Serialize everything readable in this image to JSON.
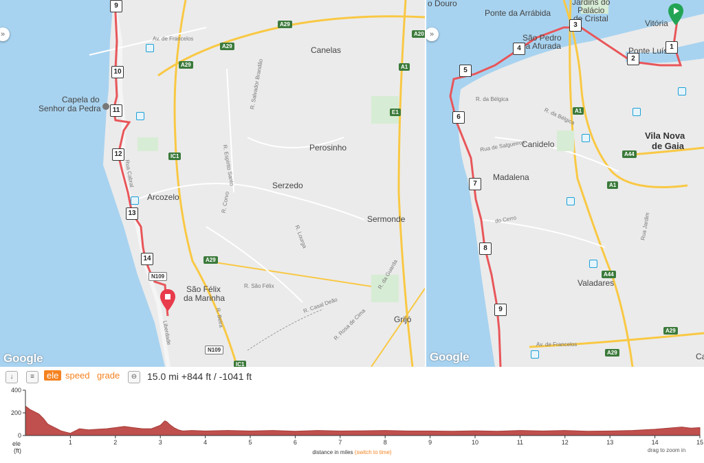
{
  "map_left": {
    "places": {
      "canelas": "Canelas",
      "perosinho": "Perosinho",
      "serzedo": "Serzedo",
      "sermonde": "Sermonde",
      "arcozelo": "Arcozelo",
      "sao_felix": "São Félix",
      "da_marinha": "da Marinha",
      "grijo": "Grijó",
      "capela": "Capela do",
      "senhor": "Senhor da Pedra"
    },
    "streets": [
      "Av. de Francelos",
      "R. Salvador Brandão",
      "R. Espírito Santo",
      "R. Corvo",
      "R. Lourga",
      "R. São Félix",
      "R. Casal Deão",
      "R. da Guarda",
      "R. Rosa de Cima",
      "R. Beira",
      "Liberdade",
      "Rua Cabral"
    ],
    "shields": [
      "A29",
      "A29",
      "A29",
      "A29",
      "A20",
      "A1",
      "E1",
      "IC1",
      "N109",
      "N109",
      "IC1"
    ],
    "markers": [
      "9",
      "10",
      "11",
      "12",
      "13",
      "14"
    ],
    "google": "Google"
  },
  "map_right": {
    "places": {
      "vitoria": "Vitória",
      "vila_nova": "Vila Nova",
      "de_gaia": "de Gaia",
      "canidelo": "Canidelo",
      "madalena": "Madalena",
      "valadares": "Valadares",
      "sao_pedro": "São Pedro",
      "da_afurada": "da Afurada",
      "ponte_arrabida": "Ponte da Arrábida",
      "jardins": "Jardins do",
      "palacio": "Palácio",
      "de_cristal": "de Cristal",
      "ponte_luis": "Ponte Luís I",
      "douro": "o Douro",
      "ca": "Ca"
    },
    "streets": [
      "R. da Bélgica",
      "R. da Bélgica",
      "Rua de Salgueiros",
      "do Cerro",
      "Av. de Francelos",
      "Rua Jardim"
    ],
    "shields": [
      "A1",
      "A44",
      "A1",
      "A44",
      "A29",
      "A29"
    ],
    "markers": [
      "1",
      "2",
      "3",
      "4",
      "5",
      "6",
      "7",
      "8",
      "9"
    ],
    "google": "Google"
  },
  "toolbar": {
    "tabs": [
      "ele",
      "speed",
      "grade"
    ],
    "active_tab": "ele",
    "stats": "15.0 mi +844 ft / -1041 ft"
  },
  "chart_data": {
    "type": "area",
    "ylabel": "ele (ft)",
    "ylabel_line1": "ele",
    "ylabel_line2": "(ft)",
    "xlabel": "distance in miles",
    "xlabel_link": "(switch to time)",
    "hint": "drag to zoom in",
    "ylim": [
      0,
      400
    ],
    "xlim": [
      0,
      15
    ],
    "yticks": [
      0,
      200,
      400
    ],
    "xticks": [
      1,
      2,
      3,
      4,
      5,
      6,
      7,
      8,
      9,
      10,
      11,
      12,
      13,
      14,
      15
    ],
    "color": "#c0504d",
    "x": [
      0,
      0.1,
      0.2,
      0.3,
      0.4,
      0.5,
      0.6,
      0.7,
      0.8,
      0.9,
      1.0,
      1.1,
      1.2,
      1.4,
      1.6,
      1.8,
      2.0,
      2.2,
      2.4,
      2.6,
      2.8,
      3.0,
      3.1,
      3.15,
      3.2,
      3.3,
      3.4,
      3.5,
      3.7,
      4.0,
      4.5,
      5.0,
      5.5,
      6.0,
      6.5,
      7.0,
      7.5,
      8.0,
      8.5,
      9.0,
      9.5,
      10.0,
      10.5,
      11.0,
      11.5,
      12.0,
      12.5,
      13.0,
      13.5,
      14.0,
      14.3,
      14.6,
      14.8,
      15.0
    ],
    "y": [
      260,
      230,
      210,
      190,
      150,
      100,
      80,
      60,
      40,
      30,
      20,
      40,
      60,
      50,
      55,
      60,
      70,
      80,
      70,
      60,
      60,
      90,
      130,
      120,
      100,
      70,
      50,
      40,
      45,
      40,
      45,
      40,
      45,
      38,
      45,
      40,
      42,
      45,
      40,
      40,
      38,
      42,
      38,
      45,
      40,
      45,
      38,
      40,
      45,
      55,
      65,
      75,
      65,
      70
    ]
  }
}
